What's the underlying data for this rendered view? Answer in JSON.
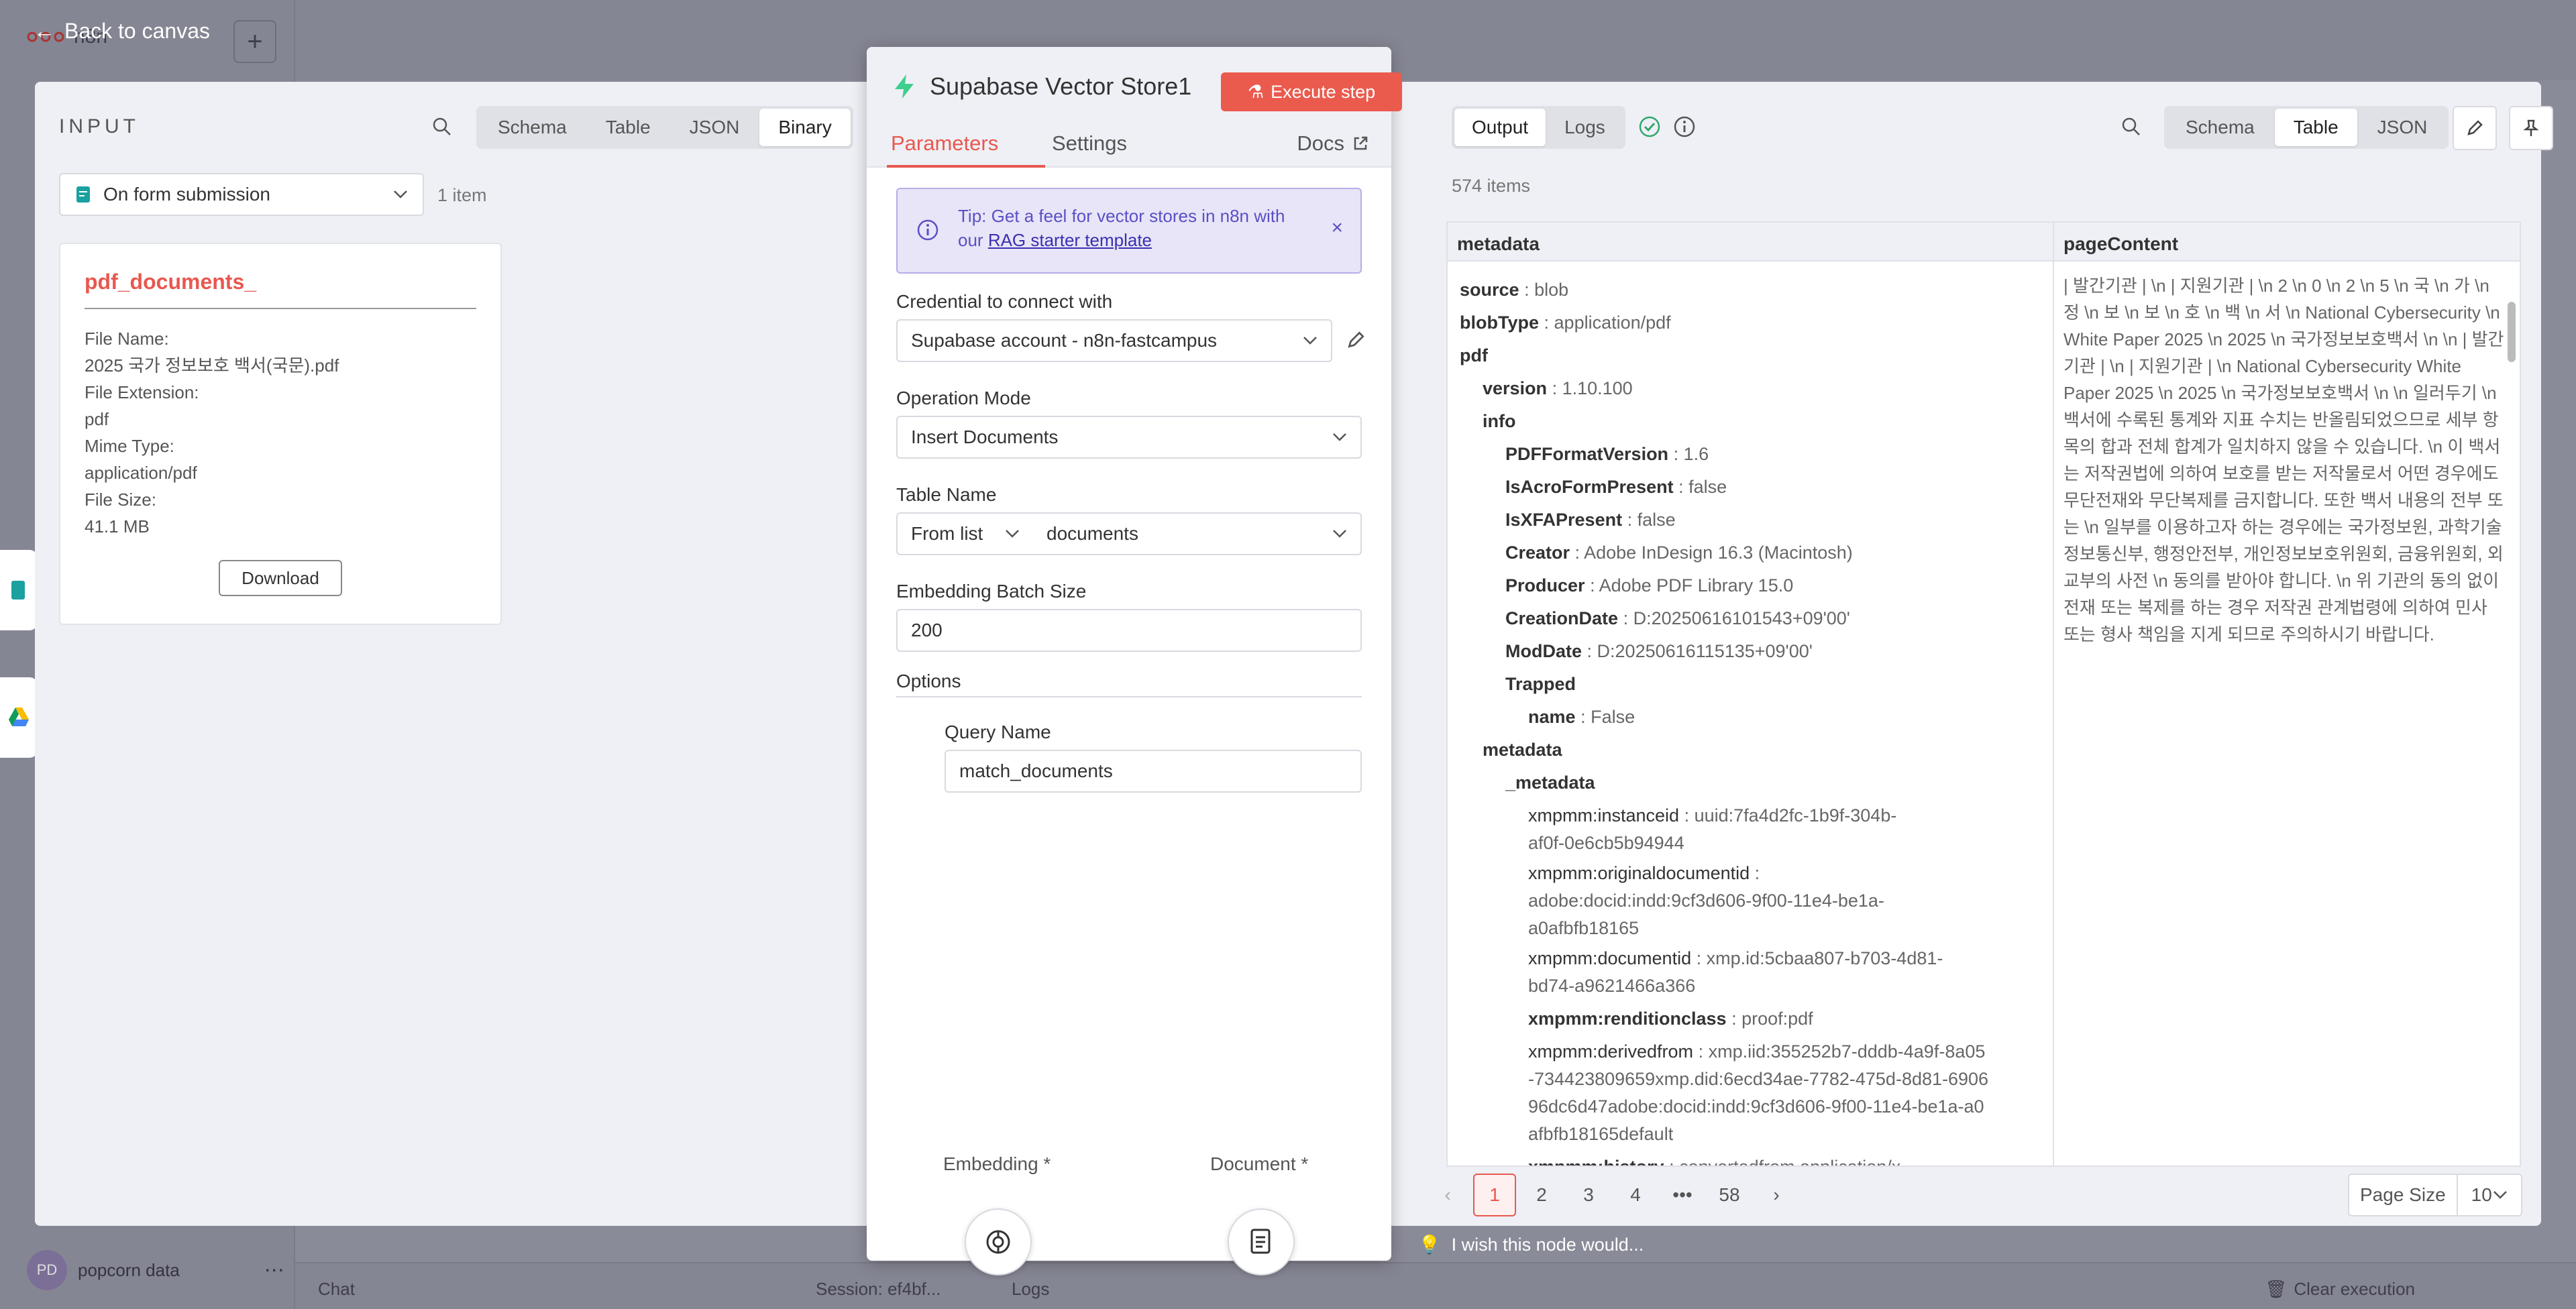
{
  "app": {
    "back_label": "Back to canvas",
    "brand": "n8n",
    "user_initials": "PD",
    "user_name": "popcorn data",
    "chat_label": "Chat",
    "session_label": "Session: ef4bf...",
    "logs_label": "Logs",
    "clear_label": "Clear execution",
    "wish_label": "I wish this node would..."
  },
  "input": {
    "title": "INPUT",
    "view_tabs": [
      "Schema",
      "Table",
      "JSON",
      "Binary"
    ],
    "active_tab": "Binary",
    "node_select": "On form submission",
    "item_count": "1 item",
    "binary": {
      "name": "pdf_documents_",
      "file_name_label": "File Name:",
      "file_name": "2025 국가 정보보호 백서(국문).pdf",
      "extension_label": "File Extension:",
      "extension": "pdf",
      "mime_label": "Mime Type:",
      "mime": "application/pdf",
      "size_label": "File Size:",
      "size": "41.1 MB",
      "download_label": "Download"
    }
  },
  "params": {
    "node_title": "Supabase Vector Store1",
    "execute_label": "Execute step",
    "tabs": [
      "Parameters",
      "Settings"
    ],
    "active_tab": "Parameters",
    "docs_label": "Docs",
    "tip_text": "Tip: Get a feel for vector stores in n8n with our",
    "tip_link": "RAG starter template",
    "credential_label": "Credential to connect with",
    "credential_value": "Supabase account - n8n-fastcampus",
    "operation_label": "Operation Mode",
    "operation_value": "Insert Documents",
    "table_label": "Table Name",
    "table_source": "From list",
    "table_value": "documents",
    "batch_label": "Embedding Batch Size",
    "batch_value": "200",
    "options_label": "Options",
    "query_label": "Query Name",
    "query_value": "match_documents",
    "sub_embedding": "Embedding *",
    "sub_document": "Document *"
  },
  "output": {
    "mode_tabs": [
      "Output",
      "Logs"
    ],
    "active_mode": "Output",
    "items_count": "574 items",
    "view_tabs": [
      "Schema",
      "Table",
      "JSON"
    ],
    "active_view": "Table",
    "columns": [
      "metadata",
      "pageContent"
    ],
    "metadata": {
      "source": "blob",
      "blobType": "application/pdf",
      "pdf": "",
      "version": "1.10.100",
      "info": "",
      "PDFFormatVersion": "1.6",
      "IsAcroFormPresent": "false",
      "IsXFAPresent": "false",
      "Creator": "Adobe InDesign 16.3 (Macintosh)",
      "Producer": "Adobe PDF Library 15.0",
      "CreationDate": "D:20250616101543+09'00'",
      "ModDate": "D:20250616115135+09'00'",
      "Trapped": "",
      "name": "False",
      "metadata": "",
      "_metadata": "",
      "instanceid": "uuid:7fa4d2fc-1b9f-304b-af0f-0e6cb5b94944",
      "originaldocumentid": "adobe:docid:indd:9cf3d606-9f00-11e4-be1a-a0afbfb18165",
      "documentid": "xmp.id:5cbaa807-b703-4d81-bd74-a9621466a366",
      "renditionclass": "proof:pdf",
      "derivedfrom": "xmp.iid:355252b7-dddb-4a9f-8a05-734423809659xmp.did:6ecd34ae-7782-475d-8d81-690696dc6d47adobe:docid:indd:9cf3d606-9f00-11e4-be1a-a0afbfb18165default",
      "history": "convertedfrom application/x-"
    },
    "keys": {
      "instanceid": "xmpmm:instanceid",
      "originaldocumentid": "xmpmm:originaldocumentid",
      "documentid": "xmpmm:documentid",
      "renditionclass": "xmpmm:renditionclass",
      "derivedfrom": "xmpmm:derivedfrom",
      "history": "xmpmm:history"
    },
    "page_content": "| 발간기관 | \\n | 지원기관 | \\n 2 \\n 0 \\n 2 \\n 5 \\n 국 \\n 가 \\n 정 \\n 보 \\n 보 \\n 호 \\n 백 \\n 서 \\n National Cybersecurity \\n White Paper 2025 \\n 2025 \\n 국가정보보호백서 \\n \\n | 발간기관 | \\n | 지원기관 | \\n National Cybersecurity White Paper 2025 \\n 2025 \\n 국가정보보호백서 \\n \\n 일러두기 \\n 백서에 수록된 통계와 지표 수치는 반올림되었으므로 세부 항목의 합과 전체 합계가 일치하지 않을 수 있습니다. \\n 이 백서는 저작권법에 의하여 보호를 받는 저작물로서 어떤 경우에도 무단전재와 무단복제를 금지합니다. 또한 백서 내용의 전부 또는 \\n 일부를 이용하고자 하는 경우에는 국가정보원, 과학기술정보통신부, 행정안전부, 개인정보보호위원회, 금융위원회, 외교부의 사전 \\n 동의를 받아야 합니다. \\n 위 기관의 동의 없이 전재 또는 복제를 하는 경우 저작권 관계법령에 의하여 민사 또는 형사 책임을 지게 되므로 주의하시기 바랍니다.",
    "pages": [
      "1",
      "2",
      "3",
      "4",
      "•••",
      "58"
    ],
    "active_page": "1",
    "page_size_label": "Page Size",
    "page_size_value": "10"
  },
  "colors": {
    "accent": "#e8584f",
    "tip": "#5a4fc6",
    "success": "#2fa86a"
  }
}
